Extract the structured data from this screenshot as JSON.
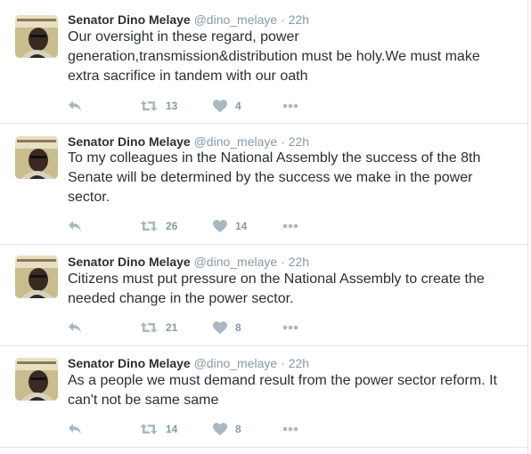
{
  "author": {
    "fullname": "Senator Dino Melaye",
    "username": "@dino_melaye",
    "separator": "·"
  },
  "icons": {
    "reply": "reply-icon",
    "retweet": "retweet-icon",
    "like": "heart-icon",
    "more": "more-dots-icon"
  },
  "colors": {
    "name": "#292f33",
    "meta": "#8899a6",
    "icon": "#aab8c2",
    "divider": "#e1e8ed"
  },
  "tweets": [
    {
      "time": "22h",
      "text": "Our oversight in these regard, power generation,transmission&distribution must be holy.We must make extra sacrifice in tandem  with our oath",
      "retweets": "13",
      "likes": "4"
    },
    {
      "time": "22h",
      "text": "To my colleagues in the National Assembly the success of the 8th Senate will be determined by the success we make in the power sector.",
      "retweets": "26",
      "likes": "14"
    },
    {
      "time": "22h",
      "text": "Citizens must put pressure on the National Assembly to create the needed change in the power sector.",
      "retweets": "21",
      "likes": "8"
    },
    {
      "time": "22h",
      "text": "As a people we must demand result from the power sector reform. It can't not be same same",
      "retweets": "14",
      "likes": "8"
    }
  ]
}
